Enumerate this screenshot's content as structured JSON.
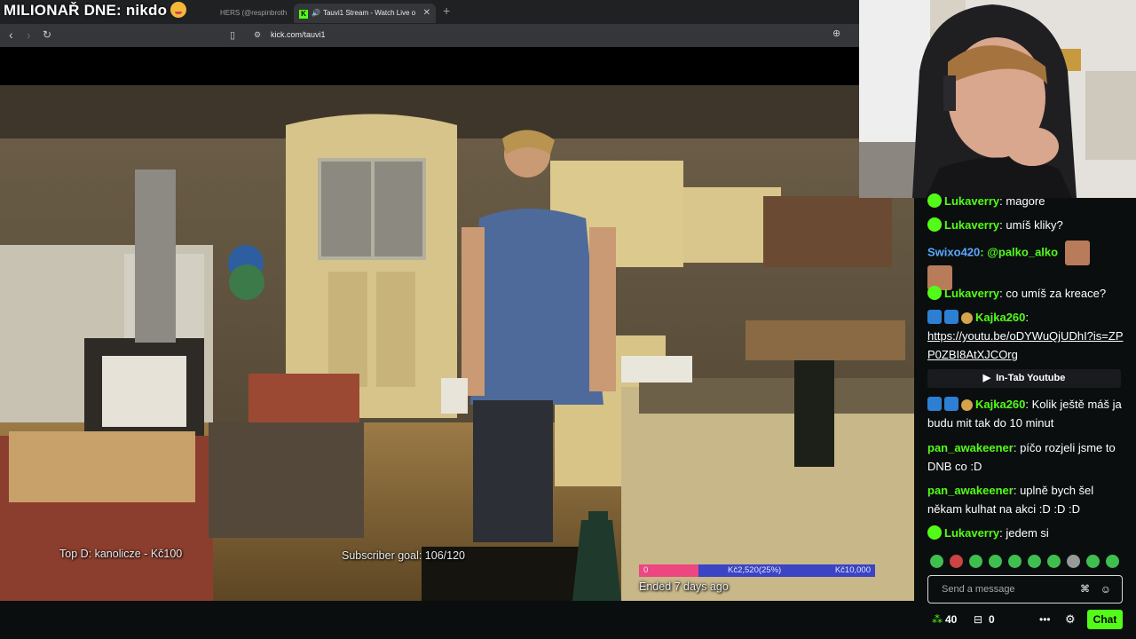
{
  "stream_title": "MILIONAŘ DNE: nikdo",
  "browser": {
    "prev_tab_text": "HERS (@respinbroth",
    "active_tab_title": "Tauvi1 Stream - Watch Live o",
    "url": "kick.com/tauvi1"
  },
  "overlay": {
    "top_donor": "Top D: kanolicze - Kč100",
    "subscriber_goal": "Subscriber goal: 106/120",
    "goal_start": "0",
    "goal_progress_label": "Kč2,520(25%)",
    "goal_end": "Kč10,000",
    "goal_status": "Ended 7 days ago",
    "goal_fraction": 0.25
  },
  "chat": {
    "messages": [
      {
        "user": "Lukaverry",
        "text": ": magore"
      },
      {
        "user": "Lukaverry",
        "text": ": umíš kliky?"
      },
      {
        "user": "Swixo420",
        "text": ": @palko_alko"
      },
      {
        "user": "Lukaverry",
        "text": ": co umíš za kreace?"
      },
      {
        "user": "Kajka260",
        "text": ":",
        "link": "https://youtu.be/oDYWuQjUDhI?is=ZPP0ZBI8AtXJCOrg"
      },
      {
        "user": "Kajka260",
        "text": ": Kolik ještě máš ja budu mit tak do 10 minut"
      },
      {
        "user": "pan_awakeener",
        "text": ": píčo rozjeli jsme to DNB co :D"
      },
      {
        "user": "pan_awakeener",
        "text": ": uplně bych šel někam kulhat na akci :D :D :D"
      },
      {
        "user": "Lukaverry",
        "text": ": jedem si"
      }
    ],
    "intab_label": "In-Tab Youtube",
    "input_placeholder": "Send a message",
    "points_count": "40",
    "gift_count": "0",
    "chat_button": "Chat"
  },
  "colors": {
    "accent": "#53fc18",
    "goal_pink": "#ec4780",
    "goal_blue": "#3a44c4"
  }
}
